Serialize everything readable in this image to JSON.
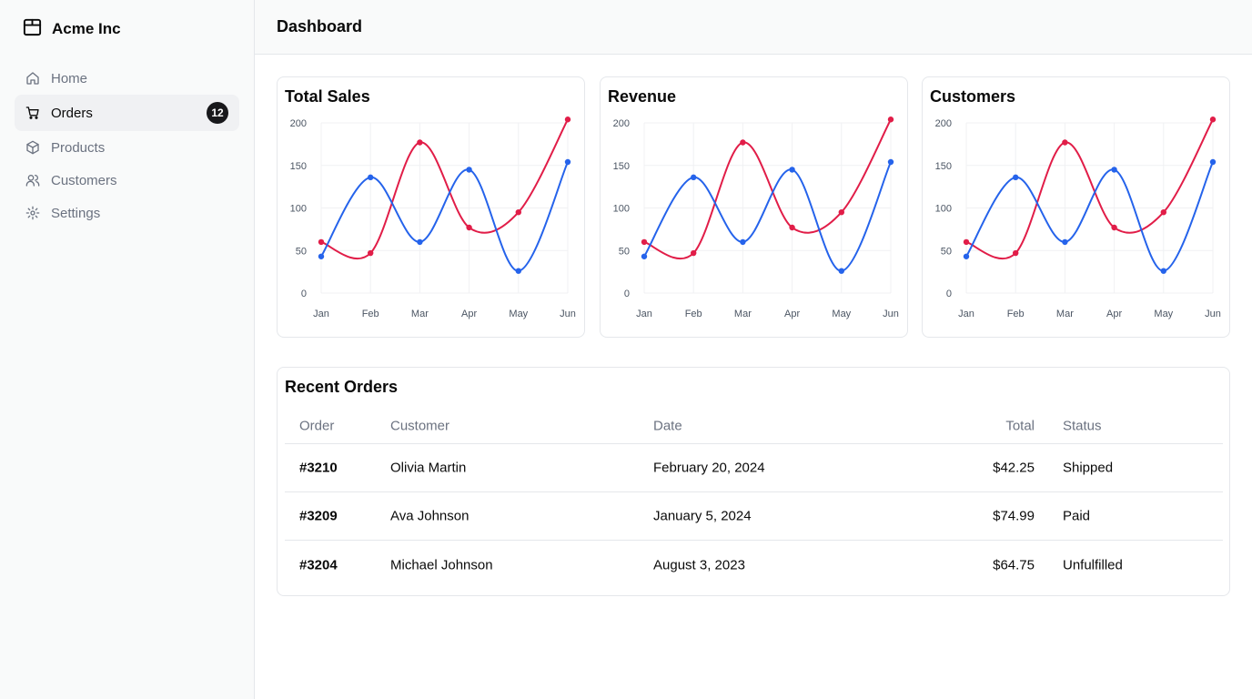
{
  "brand": {
    "name": "Acme Inc",
    "icon": "package-icon"
  },
  "nav": [
    {
      "label": "Home",
      "icon": "home-icon",
      "active": false,
      "badge": ""
    },
    {
      "label": "Orders",
      "icon": "cart-icon",
      "active": true,
      "badge": "12"
    },
    {
      "label": "Products",
      "icon": "box-icon",
      "active": false,
      "badge": ""
    },
    {
      "label": "Customers",
      "icon": "users-icon",
      "active": false,
      "badge": ""
    },
    {
      "label": "Settings",
      "icon": "gear-icon",
      "active": false,
      "badge": ""
    }
  ],
  "header": {
    "title": "Dashboard"
  },
  "colors": {
    "series_red": "#e11d48",
    "series_blue": "#2563eb",
    "accent_dark": "#18181b"
  },
  "chart_data": [
    {
      "type": "line",
      "title": "Total Sales",
      "categories": [
        "Jan",
        "Feb",
        "Mar",
        "Apr",
        "May",
        "Jun"
      ],
      "yticks": [
        "0",
        "50",
        "100",
        "150",
        "200"
      ],
      "ylim": [
        0,
        200
      ],
      "grid": true,
      "legend": "none",
      "series": [
        {
          "values": [
            60,
            47,
            177,
            77,
            95,
            204
          ],
          "color": "#e11d48"
        },
        {
          "values": [
            43,
            136,
            60,
            145,
            26,
            154
          ],
          "color": "#2563eb"
        }
      ]
    },
    {
      "type": "line",
      "title": "Revenue",
      "categories": [
        "Jan",
        "Feb",
        "Mar",
        "Apr",
        "May",
        "Jun"
      ],
      "yticks": [
        "0",
        "50",
        "100",
        "150",
        "200"
      ],
      "ylim": [
        0,
        200
      ],
      "grid": true,
      "legend": "none",
      "series": [
        {
          "values": [
            60,
            47,
            177,
            77,
            95,
            204
          ],
          "color": "#e11d48"
        },
        {
          "values": [
            43,
            136,
            60,
            145,
            26,
            154
          ],
          "color": "#2563eb"
        }
      ]
    },
    {
      "type": "line",
      "title": "Customers",
      "categories": [
        "Jan",
        "Feb",
        "Mar",
        "Apr",
        "May",
        "Jun"
      ],
      "yticks": [
        "0",
        "50",
        "100",
        "150",
        "200"
      ],
      "ylim": [
        0,
        200
      ],
      "grid": true,
      "legend": "none",
      "series": [
        {
          "values": [
            60,
            47,
            177,
            77,
            95,
            204
          ],
          "color": "#e11d48"
        },
        {
          "values": [
            43,
            136,
            60,
            145,
            26,
            154
          ],
          "color": "#2563eb"
        }
      ]
    }
  ],
  "orders": {
    "title": "Recent Orders",
    "columns": {
      "order": "Order",
      "customer": "Customer",
      "date": "Date",
      "total": "Total",
      "status": "Status"
    },
    "rows": [
      {
        "order": "#3210",
        "customer": "Olivia Martin",
        "date": "February 20, 2024",
        "total": "$42.25",
        "status": "Shipped"
      },
      {
        "order": "#3209",
        "customer": "Ava Johnson",
        "date": "January 5, 2024",
        "total": "$74.99",
        "status": "Paid"
      },
      {
        "order": "#3204",
        "customer": "Michael Johnson",
        "date": "August 3, 2023",
        "total": "$64.75",
        "status": "Unfulfilled"
      }
    ]
  }
}
